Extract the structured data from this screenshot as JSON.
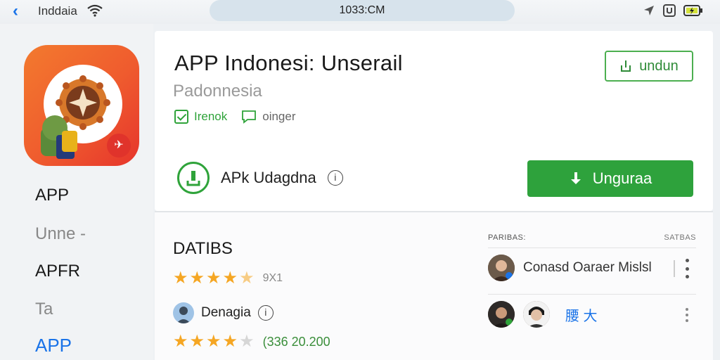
{
  "status_bar": {
    "carrier": "Inddaia",
    "time": "1033:CM"
  },
  "sidebar": {
    "items": [
      {
        "label": "APP"
      },
      {
        "label": "Unne -"
      },
      {
        "label": "APFR"
      },
      {
        "label": "Ta"
      },
      {
        "label": "APP"
      }
    ]
  },
  "app": {
    "title": "APP Indonesi: Unserail",
    "subtitle": "Padonnesia",
    "tag_verified": "Irenok",
    "tag_chat": "oinger",
    "undun_label": "undun",
    "apk_label": "APk Udagdna",
    "download_label": "Ungurаa"
  },
  "details": {
    "title": "DATIBS",
    "rating_1": {
      "stars": 4.5,
      "value": "9X1"
    },
    "developer": "Denagia",
    "rating_2": {
      "stars": 4,
      "value": "(336 20.200"
    }
  },
  "reviews": {
    "header_left": "PARIBAS:",
    "header_right": "SATBAS",
    "users": [
      {
        "name": "Conasd Oarаer Mislsl"
      },
      {
        "name": "腰 大"
      }
    ]
  },
  "colors": {
    "accent_green": "#2ea23c",
    "accent_blue": "#1a73e8",
    "icon_orange": "#f37a2e",
    "star": "#f5a623"
  }
}
